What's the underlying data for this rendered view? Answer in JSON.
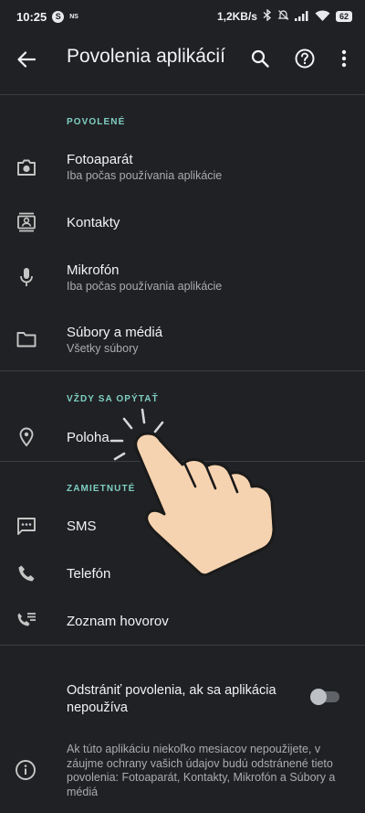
{
  "status_bar": {
    "time": "10:25",
    "s_badge": "S",
    "ns_label": "NS",
    "net_speed": "1,2KB/s",
    "battery": "62"
  },
  "app_bar": {
    "title": "Povolenia aplikácií",
    "icons": [
      "back-arrow-icon",
      "search-icon",
      "help-icon",
      "more-vert-icon"
    ]
  },
  "sections": {
    "allowed": {
      "header": "POVOLENÉ",
      "items": [
        {
          "title": "Fotoaparát",
          "subtitle": "Iba počas používania aplikácie",
          "icon": "camera-icon"
        },
        {
          "title": "Kontakty",
          "icon": "contacts-icon"
        },
        {
          "title": "Mikrofón",
          "subtitle": "Iba počas používania aplikácie",
          "icon": "mic-icon"
        },
        {
          "title": "Súbory a médiá",
          "subtitle": "Všetky súbory",
          "icon": "folder-icon"
        }
      ]
    },
    "ask": {
      "header": "VŽDY SA OPÝTAŤ",
      "items": [
        {
          "title": "Poloha",
          "icon": "location-icon"
        }
      ]
    },
    "denied": {
      "header": "ZAMIETNUTÉ",
      "items": [
        {
          "title": "SMS",
          "icon": "sms-icon"
        },
        {
          "title": "Telefón",
          "icon": "phone-icon"
        },
        {
          "title": "Zoznam hovorov",
          "icon": "call-log-icon"
        }
      ]
    }
  },
  "remove_permissions": {
    "label": "Odstrániť povolenia, ak sa aplikácia nepoužíva",
    "enabled": false
  },
  "footer": {
    "text": "Ak túto aplikáciu niekoľko mesiacov nepoužijete, v záujme ochrany vašich údajov budú odstránené tieto povolenia: Fotoaparát, Kontakty, Mikrofón a Súbory a médiá",
    "icon": "info-icon"
  },
  "colors": {
    "background": "#202124",
    "accent": "#7fcfc4",
    "text": "#f1f3f4",
    "secondary_text": "#a9acb0"
  }
}
